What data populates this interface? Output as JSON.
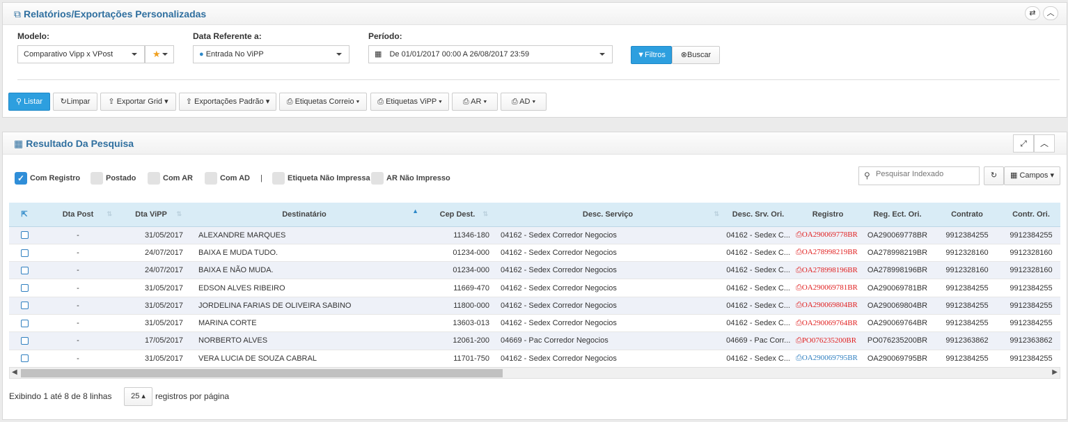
{
  "panel1": {
    "title": "Relatórios/Exportações Personalizadas",
    "title_icon": "external-link-icon",
    "modelo_label": "Modelo:",
    "modelo_value": "Comparativo Vipp x VPost",
    "data_ref_label": "Data Referente a:",
    "data_ref_value": "Entrada No ViPP",
    "periodo_label": "Período:",
    "periodo_value": "De 01/01/2017 00:00 A 26/08/2017 23:59",
    "filtros_label": "Filtros",
    "buscar_label": "Buscar",
    "toolbar": {
      "listar": "Listar",
      "limpar": "Limpar",
      "exportar_grid": "Exportar Grid",
      "exportacoes_padrao": "Exportações Padrão",
      "etiquetas_correio": "Etiquetas Correio",
      "etiquetas_vipp": "Etiquetas ViPP",
      "ar": "AR",
      "ad": "AD"
    }
  },
  "panel2": {
    "title": "Resultado Da Pesquisa",
    "filters": [
      {
        "label": "Com Registro",
        "checked": true
      },
      {
        "label": "Postado",
        "checked": false
      },
      {
        "label": "Com AR",
        "checked": false
      },
      {
        "label": "Com AD",
        "checked": false
      },
      {
        "label": "Etiqueta Não Impressa",
        "checked": false
      },
      {
        "label": "AR Não Impresso",
        "checked": false
      }
    ],
    "separator": "|",
    "search_placeholder": "Pesquisar Indexado",
    "campos_label": "Campos",
    "columns": [
      "Dta Post",
      "Dta ViPP",
      "Destinatário",
      "Cep Dest.",
      "Desc. Serviço",
      "Desc. Srv. Ori.",
      "Registro",
      "Reg. Ect. Ori.",
      "Contrato",
      "Contr. Ori."
    ],
    "rows": [
      {
        "dta_post": "-",
        "dta_vipp": "31/05/2017",
        "dest": "ALEXANDRE MARQUES",
        "cep": "11346-180",
        "serv": "04162 - Sedex Corredor Negocios",
        "srv_ori": "04162 - Sedex C...",
        "registro": "OA290069778BR",
        "reg_color": "red",
        "reg_ori": "OA290069778BR",
        "contrato": "9912384255",
        "contr_ori": "9912384255"
      },
      {
        "dta_post": "-",
        "dta_vipp": "24/07/2017",
        "dest": "BAIXA E MUDA TUDO.",
        "cep": "01234-000",
        "serv": "04162 - Sedex Corredor Negocios",
        "srv_ori": "04162 - Sedex C...",
        "registro": "OA278998219BR",
        "reg_color": "red",
        "reg_ori": "OA278998219BR",
        "contrato": "9912328160",
        "contr_ori": "9912328160"
      },
      {
        "dta_post": "-",
        "dta_vipp": "24/07/2017",
        "dest": "BAIXA E NÃO MUDA.",
        "cep": "01234-000",
        "serv": "04162 - Sedex Corredor Negocios",
        "srv_ori": "04162 - Sedex C...",
        "registro": "OA278998196BR",
        "reg_color": "red",
        "reg_ori": "OA278998196BR",
        "contrato": "9912328160",
        "contr_ori": "9912328160"
      },
      {
        "dta_post": "-",
        "dta_vipp": "31/05/2017",
        "dest": "EDSON ALVES RIBEIRO",
        "cep": "11669-470",
        "serv": "04162 - Sedex Corredor Negocios",
        "srv_ori": "04162 - Sedex C...",
        "registro": "OA290069781BR",
        "reg_color": "red",
        "reg_ori": "OA290069781BR",
        "contrato": "9912384255",
        "contr_ori": "9912384255"
      },
      {
        "dta_post": "-",
        "dta_vipp": "31/05/2017",
        "dest": "JORDELINA FARIAS DE OLIVEIRA SABINO",
        "cep": "11800-000",
        "serv": "04162 - Sedex Corredor Negocios",
        "srv_ori": "04162 - Sedex C...",
        "registro": "OA290069804BR",
        "reg_color": "red",
        "reg_ori": "OA290069804BR",
        "contrato": "9912384255",
        "contr_ori": "9912384255"
      },
      {
        "dta_post": "-",
        "dta_vipp": "31/05/2017",
        "dest": "MARINA CORTE",
        "cep": "13603-013",
        "serv": "04162 - Sedex Corredor Negocios",
        "srv_ori": "04162 - Sedex C...",
        "registro": "OA290069764BR",
        "reg_color": "red",
        "reg_ori": "OA290069764BR",
        "contrato": "9912384255",
        "contr_ori": "9912384255"
      },
      {
        "dta_post": "-",
        "dta_vipp": "17/05/2017",
        "dest": "NORBERTO ALVES",
        "cep": "12061-200",
        "serv": "04669 - Pac Corredor Negocios",
        "srv_ori": "04669 - Pac Corr...",
        "registro": "PO076235200BR",
        "reg_color": "red",
        "reg_ori": "PO076235200BR",
        "contrato": "9912363862",
        "contr_ori": "9912363862"
      },
      {
        "dta_post": "-",
        "dta_vipp": "31/05/2017",
        "dest": "VERA LUCIA DE SOUZA CABRAL",
        "cep": "11701-750",
        "serv": "04162 - Sedex Corredor Negocios",
        "srv_ori": "04162 - Sedex C...",
        "registro": "OA290069795BR",
        "reg_color": "blue",
        "reg_ori": "OA290069795BR",
        "contrato": "9912384255",
        "contr_ori": "9912384255"
      }
    ],
    "footer": {
      "showing": "Exibindo 1 até 8 de 8 linhas",
      "page_size": "25",
      "per_page": "registros por página"
    }
  },
  "colors": {
    "accent": "#2d9fdf",
    "title": "#2f6f9f",
    "header_bg": "#d9ecf6",
    "row_alt": "#eef1f8",
    "reg_red": "#e02020",
    "reg_blue": "#2f7fc0"
  }
}
